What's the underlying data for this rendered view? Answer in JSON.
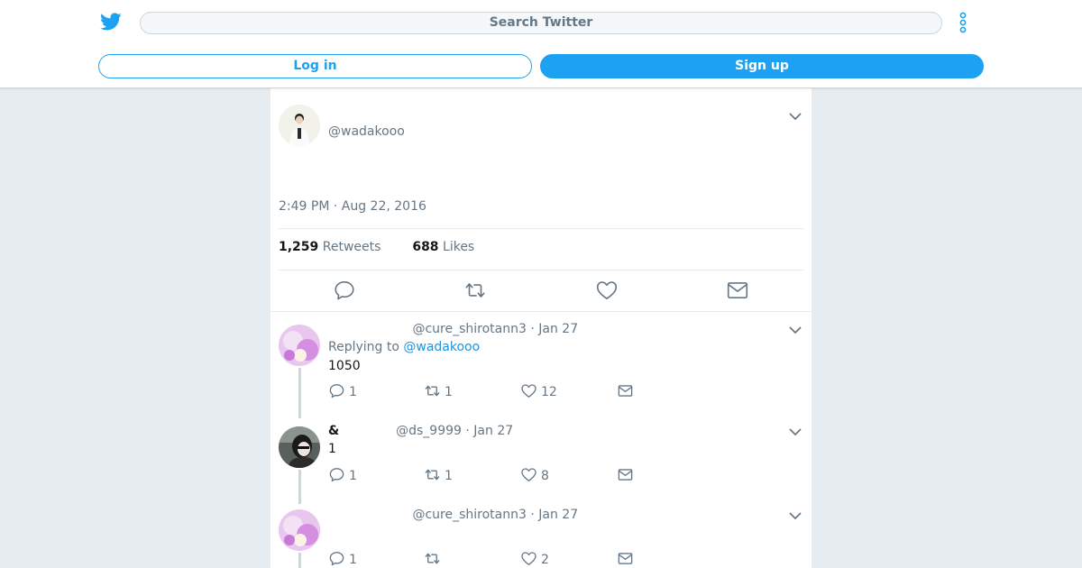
{
  "header": {
    "search_placeholder": "Search Twitter",
    "login_label": "Log in",
    "signup_label": "Sign up",
    "brand_color": "#1da1f2"
  },
  "main_tweet": {
    "handle": "@wadakooo",
    "timestamp": "2:49 PM · Aug 22, 2016",
    "retweets_count": "1,259",
    "retweets_label": "Retweets",
    "likes_count": "688",
    "likes_label": "Likes"
  },
  "replies": [
    {
      "name": "",
      "handle": "@cure_shirotann3",
      "date": "Jan 27",
      "replying_prefix": "Replying to",
      "replying_to": "@wadakooo",
      "text": "1050",
      "reply_count": "1",
      "retweet_count": "1",
      "like_count": "12"
    },
    {
      "name": "&",
      "handle": "@ds_9999",
      "date": "Jan 27",
      "text": "1",
      "reply_count": "1",
      "retweet_count": "1",
      "like_count": "8"
    },
    {
      "name": "",
      "handle": "@cure_shirotann3",
      "date": "Jan 27",
      "text": "",
      "reply_count": "1",
      "retweet_count": "",
      "like_count": "2"
    }
  ]
}
